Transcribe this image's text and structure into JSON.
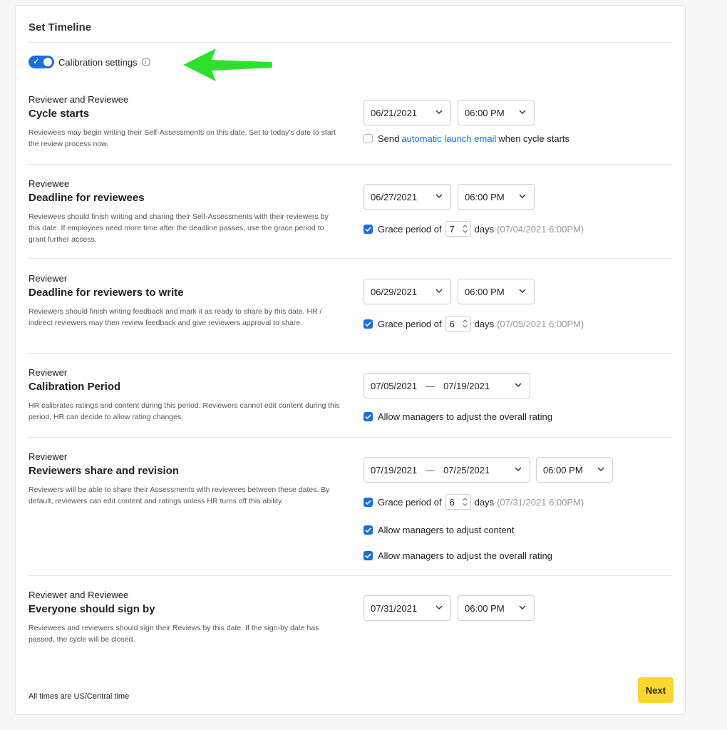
{
  "card": {
    "title": "Set Timeline"
  },
  "calibration_toggle": {
    "label": "Calibration settings",
    "on": true
  },
  "sections": [
    {
      "role": "Reviewer and Reviewee",
      "title": "Cycle starts",
      "description": "Reviewees may begin writing their Self-Assessments on this date. Set to today’s date to start the review process now.",
      "date": "06/21/2021",
      "time": "06:00 PM",
      "option": {
        "prefix": "Send",
        "link": "automatic launch email",
        "suffix": "when cycle starts",
        "checked": false
      }
    },
    {
      "role": "Reviewee",
      "title": "Deadline for reviewees",
      "description": "Reviewees should finish writing and sharing their Self-Assessments with their reviewers by this date. If employees need more time after the deadline passes, use the grace period to grant further access.",
      "date": "06/27/2021",
      "time": "06:00 PM",
      "grace": {
        "label": "Grace period of",
        "days": "7",
        "unit": "days",
        "until": "(07/04/2021 6:00PM)",
        "checked": true
      }
    },
    {
      "role": "Reviewer",
      "title": "Deadline for reviewers to write",
      "description": "Reviewers should finish writing feedback and mark it as ready to share by this date. HR / indirect reviewers may then review feedback and give reviewers approval to share.",
      "date": "06/29/2021",
      "time": "06:00 PM",
      "grace": {
        "label": "Grace period of",
        "days": "6",
        "unit": "days",
        "until": "(07/05/2021 6:00PM)",
        "checked": true
      }
    },
    {
      "role": "Reviewer",
      "title": "Calibration Period",
      "description": "HR calibrates ratings and content during this period. Reviewers cannot edit content during this period, HR can decide to allow rating changes.",
      "range_start": "07/05/2021",
      "range_sep": "—",
      "range_end": "07/19/2021",
      "option": {
        "label": "Allow managers to adjust the overall rating",
        "checked": true
      }
    },
    {
      "role": "Reviewer",
      "title": "Reviewers share and revision",
      "description": "Reviewers will be able to share their Assessments with reviewees between these dates. By default, reviewers can edit content and ratings unless HR turns off this ability.",
      "range_start": "07/19/2021",
      "range_sep": "—",
      "range_end": "07/25/2021",
      "time": "06:00 PM",
      "grace": {
        "label": "Grace period of",
        "days": "6",
        "unit": "days",
        "until": "(07/31/2021 6:00PM)",
        "checked": true
      },
      "option_content": {
        "label": "Allow managers to adjust content",
        "checked": true
      },
      "option_rating": {
        "label": "Allow managers to adjust the overall rating",
        "checked": true
      }
    },
    {
      "role": "Reviewer and Reviewee",
      "title": "Everyone should sign by",
      "description": "Reviewees and reviewers should sign their Reviews by this date. If the sign-by date has passed, the cycle will be closed.",
      "date": "07/31/2021",
      "time": "06:00 PM"
    }
  ],
  "footer": {
    "timezone_note": "All times are US/Central time",
    "next_label": "Next"
  },
  "colors": {
    "accent": "#1b6fd8",
    "next_button": "#ffd62e",
    "annotation_arrow": "#2ee02e"
  }
}
